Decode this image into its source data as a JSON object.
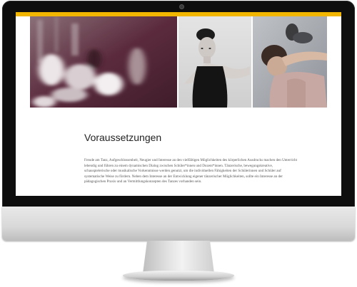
{
  "page": {
    "accent_color": "#f2b600",
    "section_title": "Voraussetzungen",
    "section_text": "Freude am Tanz, Aufgeschlossenheit, Neugier und Interesse an den vielfältigen Möglichkeiten des körperlichen Ausdrucks machen den Unterricht lebendig und führen zu einem dynamischen Dialog zwischen Schüler*innen und Dozent*innen. Tänzerische, bewegungskreative, schauspielerische oder musikalische Vorkenntnisse werden genutzt, um die individuellen Fähigkeiten der Schülerinnen und Schüler auf systematische Weise zu fördern. Neben dem Interesse an der Entwicklung eigener tänzerischer Möglichkeiten, sollte ein Interesse an der pädagogischen Praxis und an Vermittlungskonzepten des Tanzes vorhanden sein."
  },
  "images": {
    "blur_tint": "#5a2a3a",
    "items": [
      "dancers-motion-blur-photo",
      "dancer-portrait-photo",
      "dancer-stretch-photo"
    ]
  },
  "device": {
    "bezel_color": "#0e0e0e",
    "chin_color": "#dcdcdc"
  }
}
